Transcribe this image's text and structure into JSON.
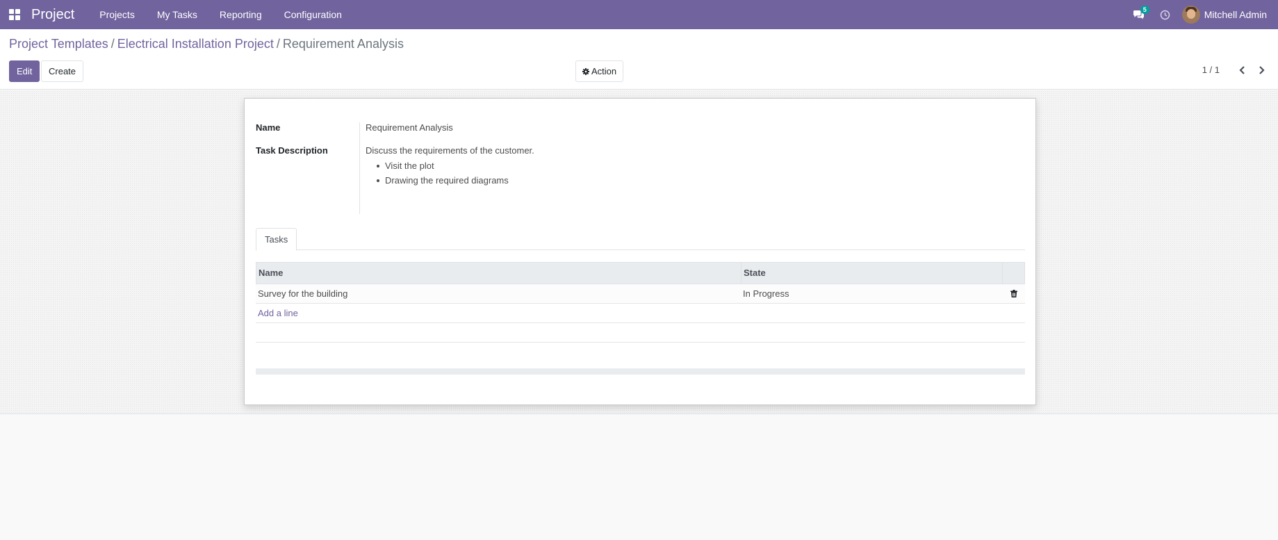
{
  "navbar": {
    "brand": "Project",
    "menu": [
      "Projects",
      "My Tasks",
      "Reporting",
      "Configuration"
    ],
    "chat_badge": "5",
    "user_name": "Mitchell Admin"
  },
  "breadcrumb": {
    "items": [
      "Project Templates",
      "Electrical Installation Project"
    ],
    "separator": "/",
    "active": "Requirement Analysis"
  },
  "buttons": {
    "edit": "Edit",
    "create": "Create",
    "action": "Action"
  },
  "pager": {
    "value": "1 / 1"
  },
  "form": {
    "name_label": "Name",
    "name_value": "Requirement Analysis",
    "desc_label": "Task Description",
    "desc_intro": "Discuss the requirements of the customer.",
    "desc_items": [
      "Visit the plot",
      "Drawing the required diagrams"
    ],
    "tab_label": "Tasks",
    "table": {
      "headers": [
        "Name",
        "State"
      ],
      "rows": [
        {
          "name": "Survey for the building",
          "state": "In Progress"
        }
      ],
      "add_line": "Add a line"
    }
  },
  "colors": {
    "brand": "#71639e",
    "badge": "#00a09d"
  }
}
